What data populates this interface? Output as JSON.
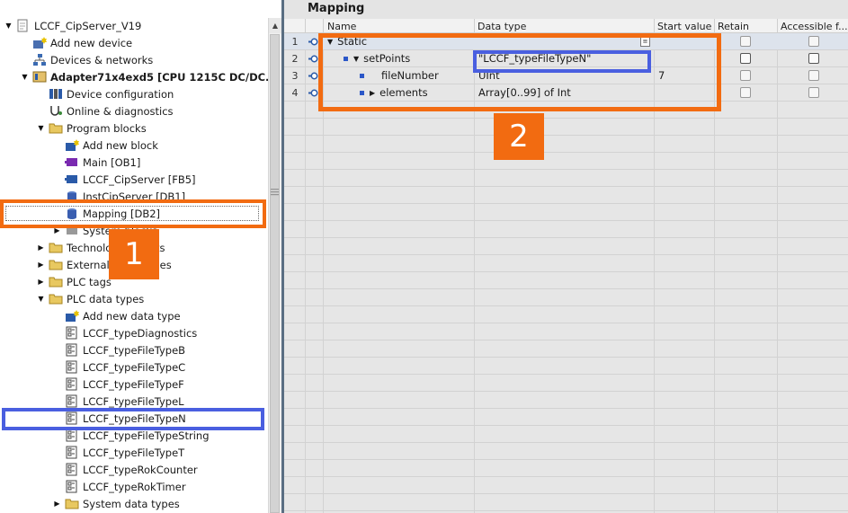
{
  "tree": {
    "items": [
      {
        "label": "LCCF_CipServer_V19",
        "icon": "project-icon",
        "exp": "down"
      },
      {
        "label": "Add new device",
        "icon": "add-device-icon",
        "exp": ""
      },
      {
        "label": "Devices & networks",
        "icon": "network-icon",
        "exp": ""
      },
      {
        "label": "Adapter71x4exd5 [CPU 1215C DC/DC...",
        "icon": "cpu-icon",
        "exp": "down"
      },
      {
        "label": "Device configuration",
        "icon": "device-config-icon",
        "exp": ""
      },
      {
        "label": "Online & diagnostics",
        "icon": "diagnostics-icon",
        "exp": ""
      },
      {
        "label": "Program blocks",
        "icon": "folder-icon",
        "exp": "down"
      },
      {
        "label": "Add new block",
        "icon": "add-block-icon",
        "exp": ""
      },
      {
        "label": "Main [OB1]",
        "icon": "ob-block-icon",
        "exp": ""
      },
      {
        "label": "LCCF_CipServer [FB5]",
        "icon": "fb-block-icon",
        "exp": ""
      },
      {
        "label": "InstCipServer [DB1]",
        "icon": "db-block-icon",
        "exp": ""
      },
      {
        "label": "Mapping [DB2]",
        "icon": "db-block-icon",
        "exp": ""
      },
      {
        "label": "System blocks",
        "icon": "system-blocks-icon",
        "exp": "right"
      },
      {
        "label": "Technology objects",
        "icon": "folder-icon",
        "exp": "right"
      },
      {
        "label": "External source files",
        "icon": "folder-icon",
        "exp": "right"
      },
      {
        "label": "PLC tags",
        "icon": "folder-icon",
        "exp": "right"
      },
      {
        "label": "PLC data types",
        "icon": "folder-icon",
        "exp": "down"
      },
      {
        "label": "Add new data type",
        "icon": "add-datatype-icon",
        "exp": ""
      },
      {
        "label": "LCCF_typeDiagnostics",
        "icon": "udt-icon",
        "exp": ""
      },
      {
        "label": "LCCF_typeFileTypeB",
        "icon": "udt-icon",
        "exp": ""
      },
      {
        "label": "LCCF_typeFileTypeC",
        "icon": "udt-icon",
        "exp": ""
      },
      {
        "label": "LCCF_typeFileTypeF",
        "icon": "udt-icon",
        "exp": ""
      },
      {
        "label": "LCCF_typeFileTypeL",
        "icon": "udt-icon",
        "exp": ""
      },
      {
        "label": "LCCF_typeFileTypeN",
        "icon": "udt-icon",
        "exp": ""
      },
      {
        "label": "LCCF_typeFileTypeString",
        "icon": "udt-icon",
        "exp": ""
      },
      {
        "label": "LCCF_typeFileTypeT",
        "icon": "udt-icon",
        "exp": ""
      },
      {
        "label": "LCCF_typeRokCounter",
        "icon": "udt-icon",
        "exp": ""
      },
      {
        "label": "LCCF_typeRokTimer",
        "icon": "udt-icon",
        "exp": ""
      },
      {
        "label": "System data types",
        "icon": "folder-icon",
        "exp": "right"
      }
    ]
  },
  "editor": {
    "title": "Mapping",
    "columns": [
      "Name",
      "Data type",
      "Start value",
      "Retain",
      "Accessible f..."
    ],
    "rows": [
      {
        "num": "1",
        "name": "Static",
        "datatype": "",
        "start": "",
        "level": 0,
        "exp": "down",
        "square": false
      },
      {
        "num": "2",
        "name": "setPoints",
        "datatype": "\"LCCF_typeFileTypeN\"",
        "start": "",
        "level": 1,
        "exp": "down",
        "square": true
      },
      {
        "num": "3",
        "name": "fileNumber",
        "datatype": "UInt",
        "start": "7",
        "level": 2,
        "exp": "",
        "square": true
      },
      {
        "num": "4",
        "name": "elements",
        "datatype": "Array[0..99] of Int",
        "start": "",
        "level": 2,
        "exp": "right",
        "square": true
      }
    ]
  },
  "annotations": {
    "badge1": "1",
    "badge2": "2",
    "orange": "#f26b11",
    "blue": "#4a5fe0"
  }
}
